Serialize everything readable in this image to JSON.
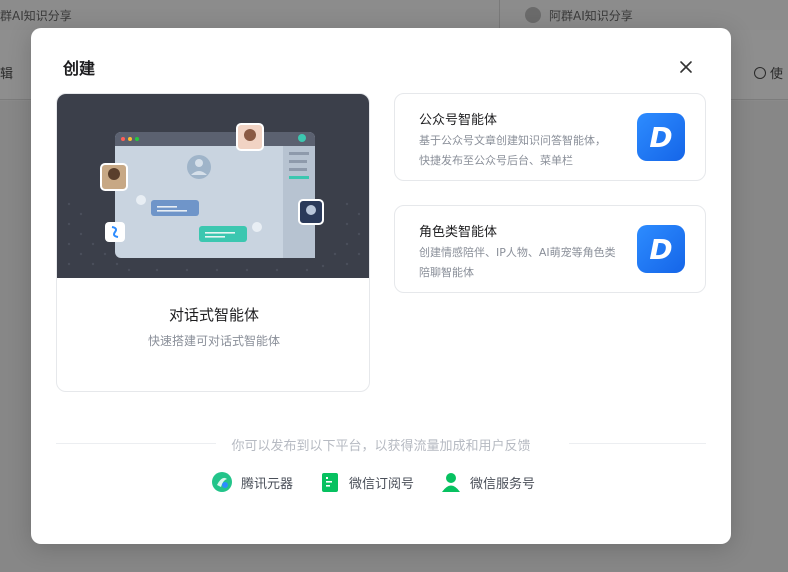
{
  "background": {
    "tab_left": "群AI知识分享",
    "tab_right": "阿群AI知识分享",
    "left_action": "辑",
    "right_action": "使"
  },
  "modal": {
    "title": "创建",
    "close_icon": "close-icon"
  },
  "cards": {
    "dialog": {
      "title": "对话式智能体",
      "desc": "快速搭建可对话式智能体"
    },
    "official": {
      "title": "公众号智能体",
      "desc": "基于公众号文章创建知识问答智能体， 快捷发布至公众号后台、菜单栏",
      "logo": "D"
    },
    "role": {
      "title": "角色类智能体",
      "desc": "创建情感陪伴、IP人物、AI萌宠等角色类陪聊智能体",
      "logo": "D"
    }
  },
  "footer": {
    "note": "你可以发布到以下平台，以获得流量加成和用户反馈",
    "platforms": [
      {
        "label": "腾讯元器",
        "icon": "yuanqi-icon",
        "color": "#23c48a"
      },
      {
        "label": "微信订阅号",
        "icon": "subscription-icon",
        "color": "#07c160"
      },
      {
        "label": "微信服务号",
        "icon": "service-account-icon",
        "color": "#07c160"
      }
    ]
  }
}
